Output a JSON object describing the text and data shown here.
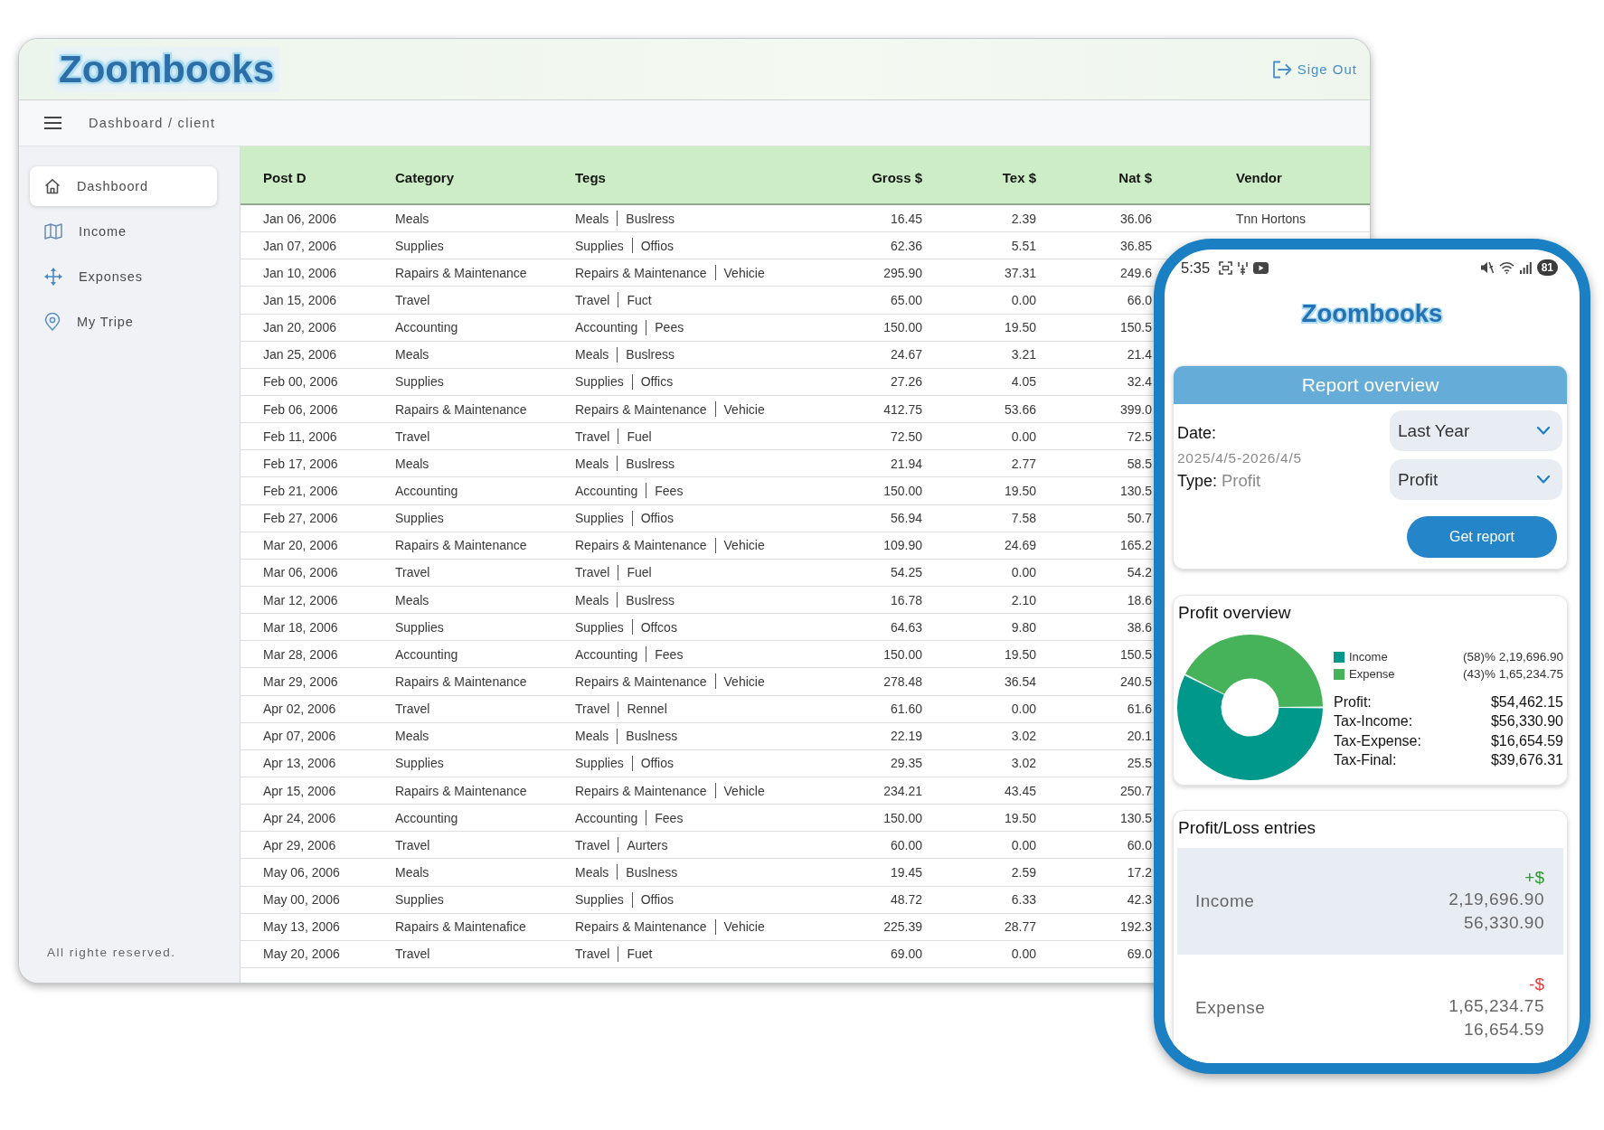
{
  "header": {
    "logo": "Zoombooks",
    "sign_out": "Sige Out"
  },
  "breadcrumb_bar": {
    "breadcrumb": "Dashboard / client"
  },
  "sidebar": {
    "items": [
      {
        "label": "Dashboord",
        "selected": true
      },
      {
        "label": "Income",
        "selected": false
      },
      {
        "label": "Exponses",
        "selected": false
      },
      {
        "label": "My Tripe",
        "selected": false
      }
    ],
    "footer": "All righte reserved."
  },
  "table": {
    "columns": [
      "Post D",
      "Category",
      "Tegs",
      "Gross $",
      "Tex $",
      "Nat $",
      "Vendor"
    ],
    "rows": [
      {
        "date": "Jan 06, 2006",
        "category": "Meals",
        "tags": [
          "Meals",
          "Buslress"
        ],
        "gross": "16.45",
        "tax": "2.39",
        "net": "36.06",
        "vendor": "Tnn Hortons"
      },
      {
        "date": "Jan 07, 2006",
        "category": "Supplies",
        "tags": [
          "Supplies",
          "Offios"
        ],
        "gross": "62.36",
        "tax": "5.51",
        "net": "36.85"
      },
      {
        "date": "Jan 10, 2006",
        "category": "Rapairs & Maintenance",
        "tags": [
          "Repairs & Maintenance",
          "Vehicie"
        ],
        "gross": "295.90",
        "tax": "37.31",
        "net": "249.6"
      },
      {
        "date": "Jan 15, 2006",
        "category": "Travel",
        "tags": [
          "Travel",
          "Fuct"
        ],
        "gross": "65.00",
        "tax": "0.00",
        "net": "66.0"
      },
      {
        "date": "Jan 20, 2006",
        "category": "Accounting",
        "tags": [
          "Accounting",
          "Pees"
        ],
        "gross": "150.00",
        "tax": "19.50",
        "net": "150.5"
      },
      {
        "date": "Jan 25, 2006",
        "category": "Meals",
        "tags": [
          "Meals",
          "Buslress"
        ],
        "gross": "24.67",
        "tax": "3.21",
        "net": "21.4"
      },
      {
        "date": "Feb 00, 2006",
        "category": "Supplies",
        "tags": [
          "Supplies",
          "Offics"
        ],
        "gross": "27.26",
        "tax": "4.05",
        "net": "32.4"
      },
      {
        "date": "Feb 06, 2006",
        "category": "Rapairs & Maintenance",
        "tags": [
          "Repairs & Maintenance",
          "Vehicie"
        ],
        "gross": "412.75",
        "tax": "53.66",
        "net": "399.0"
      },
      {
        "date": "Feb 11, 2006",
        "category": "Travel",
        "tags": [
          "Travel",
          "Fuel"
        ],
        "gross": "72.50",
        "tax": "0.00",
        "net": "72.5"
      },
      {
        "date": "Feb 17, 2006",
        "category": "Meals",
        "tags": [
          "Meals",
          "Buslress"
        ],
        "gross": "21.94",
        "tax": "2.77",
        "net": "58.5"
      },
      {
        "date": "Feb 21, 2006",
        "category": "Accounting",
        "tags": [
          "Accounting",
          "Fees"
        ],
        "gross": "150.00",
        "tax": "19.50",
        "net": "130.5"
      },
      {
        "date": "Feb 27, 2006",
        "category": "Supplies",
        "tags": [
          "Supplies",
          "Offios"
        ],
        "gross": "56.94",
        "tax": "7.58",
        "net": "50.7"
      },
      {
        "date": "Mar 20, 2006",
        "category": "Rapairs & Maintenance",
        "tags": [
          "Repairs & Maintenance",
          "Vehicie"
        ],
        "gross": "109.90",
        "tax": "24.69",
        "net": "165.2"
      },
      {
        "date": "Mar 06, 2006",
        "category": "Travel",
        "tags": [
          "Travel",
          "Fuel"
        ],
        "gross": "54.25",
        "tax": "0.00",
        "net": "54.2"
      },
      {
        "date": "Mar 12, 2006",
        "category": "Meals",
        "tags": [
          "Meals",
          "Buslress"
        ],
        "gross": "16.78",
        "tax": "2.10",
        "net": "18.6"
      },
      {
        "date": "Mar 18, 2006",
        "category": "Supplies",
        "tags": [
          "Supplies",
          "Offcos"
        ],
        "gross": "64.63",
        "tax": "9.80",
        "net": "38.6"
      },
      {
        "date": "Mar 28, 2006",
        "category": "Accounting",
        "tags": [
          "Accounting",
          "Fees"
        ],
        "gross": "150.00",
        "tax": "19.50",
        "net": "150.5"
      },
      {
        "date": "Mar 29, 2006",
        "category": "Rapairs & Maintenance",
        "tags": [
          "Repairs & Maintenance",
          "Vehicie"
        ],
        "gross": "278.48",
        "tax": "36.54",
        "net": "240.5"
      },
      {
        "date": "Apr 02, 2006",
        "category": "Travel",
        "tags": [
          "Travel",
          "Rennel"
        ],
        "gross": "61.60",
        "tax": "0.00",
        "net": "61.6"
      },
      {
        "date": "Apr 07, 2006",
        "category": "Meals",
        "tags": [
          "Meals",
          "Buslness"
        ],
        "gross": "22.19",
        "tax": "3.02",
        "net": "20.1"
      },
      {
        "date": "Apr 13, 2006",
        "category": "Supplies",
        "tags": [
          "Supplies",
          "Offios"
        ],
        "gross": "29.35",
        "tax": "3.02",
        "net": "25.5"
      },
      {
        "date": "Apr 15, 2006",
        "category": "Rapairs & Maintenance",
        "tags": [
          "Repairs & Maintenance",
          "Vehicle"
        ],
        "gross": "234.21",
        "tax": "43.45",
        "net": "250.7"
      },
      {
        "date": "Apr 24, 2006",
        "category": "Accounting",
        "tags": [
          "Accounting",
          "Fees"
        ],
        "gross": "150.00",
        "tax": "19.50",
        "net": "130.5"
      },
      {
        "date": "Apr 29, 2006",
        "category": "Travel",
        "tags": [
          "Travel",
          "Aurters"
        ],
        "gross": "60.00",
        "tax": "0.00",
        "net": "60.0"
      },
      {
        "date": "May 06, 2006",
        "category": "Meals",
        "tags": [
          "Meals",
          "Buslness"
        ],
        "gross": "19.45",
        "tax": "2.59",
        "net": "17.2"
      },
      {
        "date": "May 00, 2006",
        "category": "Supplies",
        "tags": [
          "Supplies",
          "Offios"
        ],
        "gross": "48.72",
        "tax": "6.33",
        "net": "42.3"
      },
      {
        "date": "May 13, 2006",
        "category": "Rapairs & Maintenafice",
        "tags": [
          "Repairs & Maintenance",
          "Vehicie"
        ],
        "gross": "225.39",
        "tax": "28.77",
        "net": "192.3"
      },
      {
        "date": "May 20, 2006",
        "category": "Travel",
        "tags": [
          "Travel",
          "Fuet"
        ],
        "gross": "69.00",
        "tax": "0.00",
        "net": "69.0"
      }
    ]
  },
  "phone": {
    "status_bar": {
      "time": "5:35",
      "battery": "81"
    },
    "logo": "Zoombooks",
    "report_overview": {
      "title": "Report overview",
      "date_label": "Date:",
      "date_range": "2025/4/5-2026/4/5",
      "type_label": "Type:",
      "type_value": "Profit",
      "dropdowns": [
        {
          "value": "Last Year"
        },
        {
          "value": "Profit"
        }
      ],
      "button": "Get report"
    },
    "profit_overview": {
      "title": "Profit overview",
      "chart_data": {
        "type": "donut",
        "categories": [
          "Income",
          "Expense"
        ],
        "values": [
          58,
          43
        ]
      },
      "legend": [
        {
          "color": "#00988a",
          "value": "(58)% 2,19,696.90"
        },
        {
          "color": "#46b25a",
          "value": "(43)% 1,65,234.75"
        }
      ],
      "totals": [
        {
          "label": "Profit:",
          "value": "$54,462.15"
        },
        {
          "label": "Tax-Income:",
          "value": "$56,330.90"
        },
        {
          "label": "Tax-Expense:",
          "value": "$16,654.59"
        },
        {
          "label": "Tax-Final:",
          "value": "$39,676.31"
        }
      ]
    },
    "profit_loss_entries": {
      "title": "Profit/Loss entries",
      "entries": [
        {
          "label": "Income",
          "sign": "+$",
          "color": "#2f9a34",
          "amount": "2,19,696.90",
          "tax": "56,330.90",
          "selected": true
        },
        {
          "label": "Expense",
          "sign": "-$",
          "color": "#e03c3c",
          "amount": "1,65,234.75",
          "tax": "16,654.59",
          "selected": false
        }
      ]
    }
  }
}
